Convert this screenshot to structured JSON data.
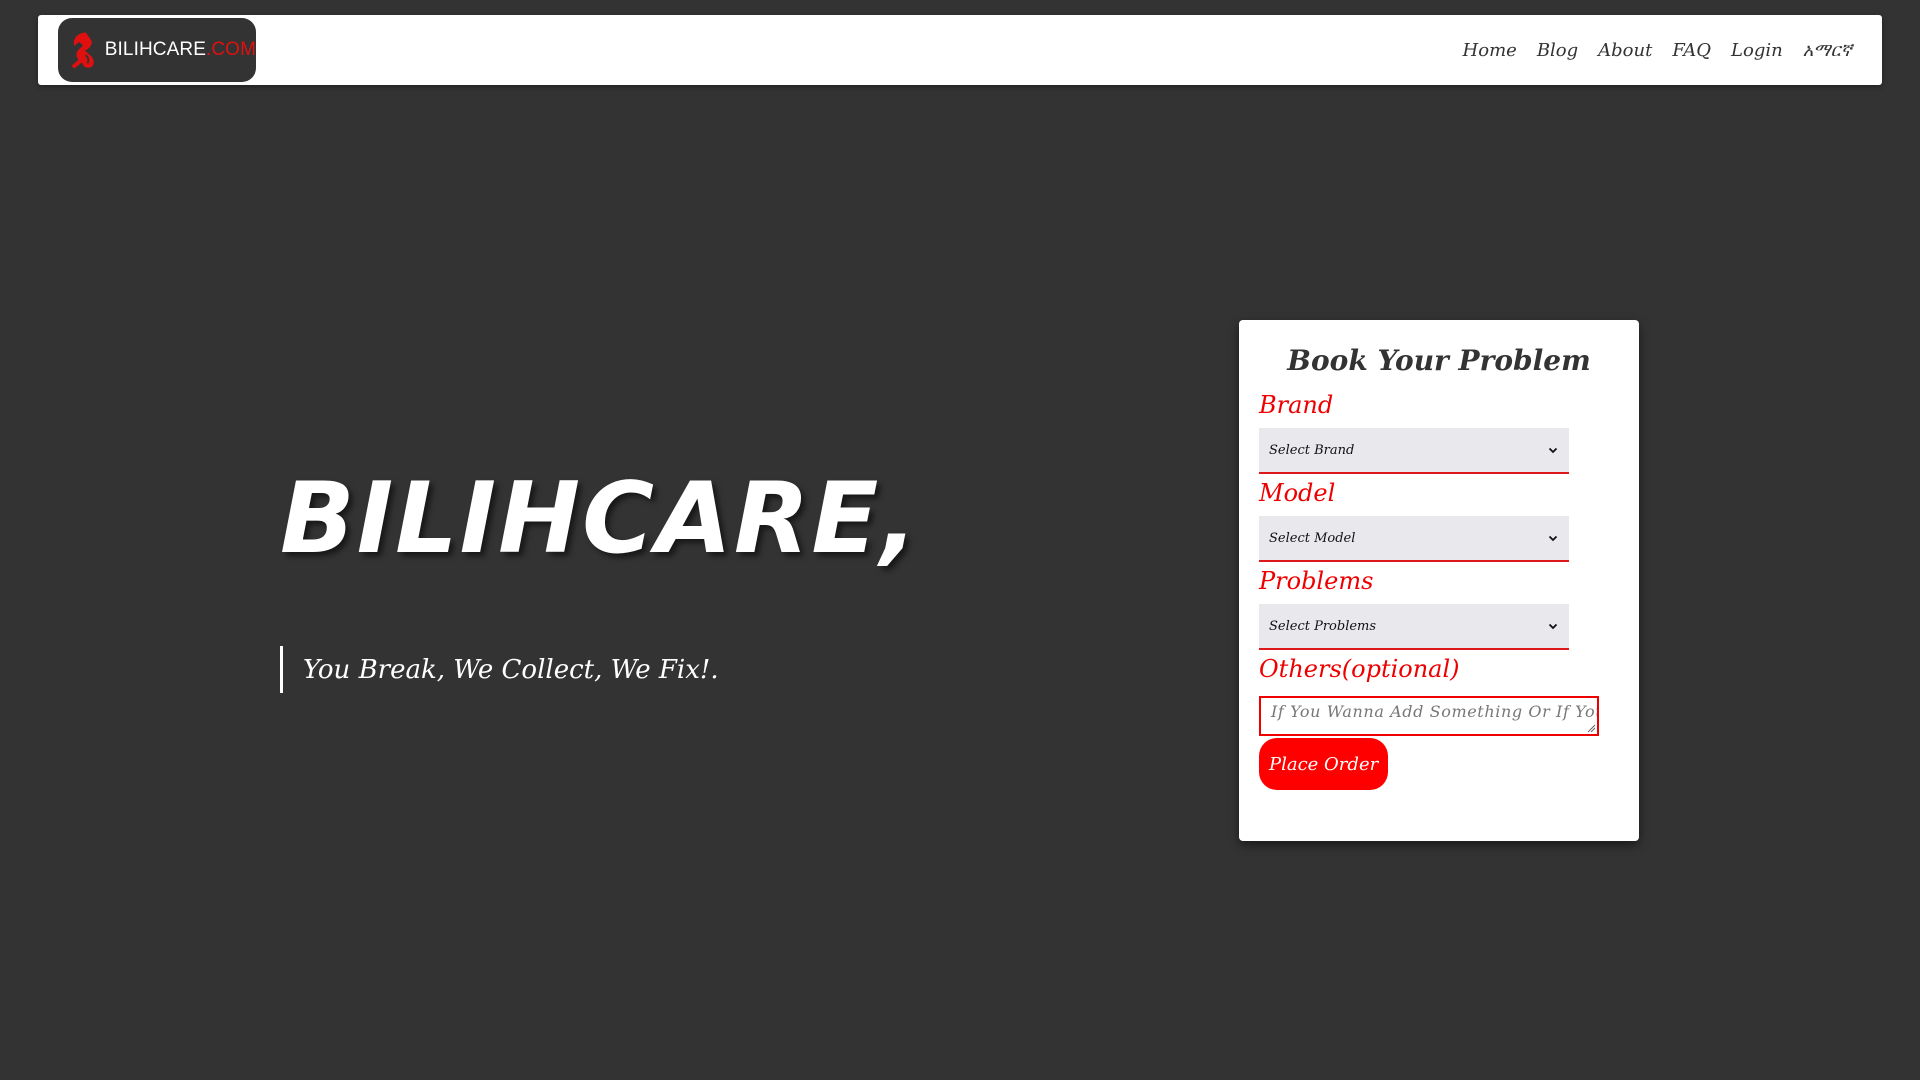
{
  "navbar": {
    "brand": {
      "name": "BILIHCARE",
      "suffix": ".COM",
      "icon": "wrench-logo-icon"
    },
    "links": [
      {
        "label": "Home"
      },
      {
        "label": "Blog"
      },
      {
        "label": "About"
      },
      {
        "label": "FAQ"
      },
      {
        "label": "Login"
      },
      {
        "label": "አማርኛ"
      }
    ]
  },
  "hero": {
    "title": "BILIHCARE,",
    "tagline": "You Break, We Collect, We Fix!."
  },
  "booking": {
    "title": "Book Your Problem",
    "fields": [
      {
        "label": "Brand",
        "selected": "Select Brand"
      },
      {
        "label": "Model",
        "selected": "Select Model"
      },
      {
        "label": "Problems",
        "selected": "Select Problems"
      }
    ],
    "others": {
      "label": "Others(optional)",
      "placeholder": "If You Wanna Add Something Or If Your"
    },
    "submit_label": "Place Order"
  },
  "colors": {
    "background": "#333333",
    "accent": "#ff0000",
    "surface": "#ffffff"
  }
}
